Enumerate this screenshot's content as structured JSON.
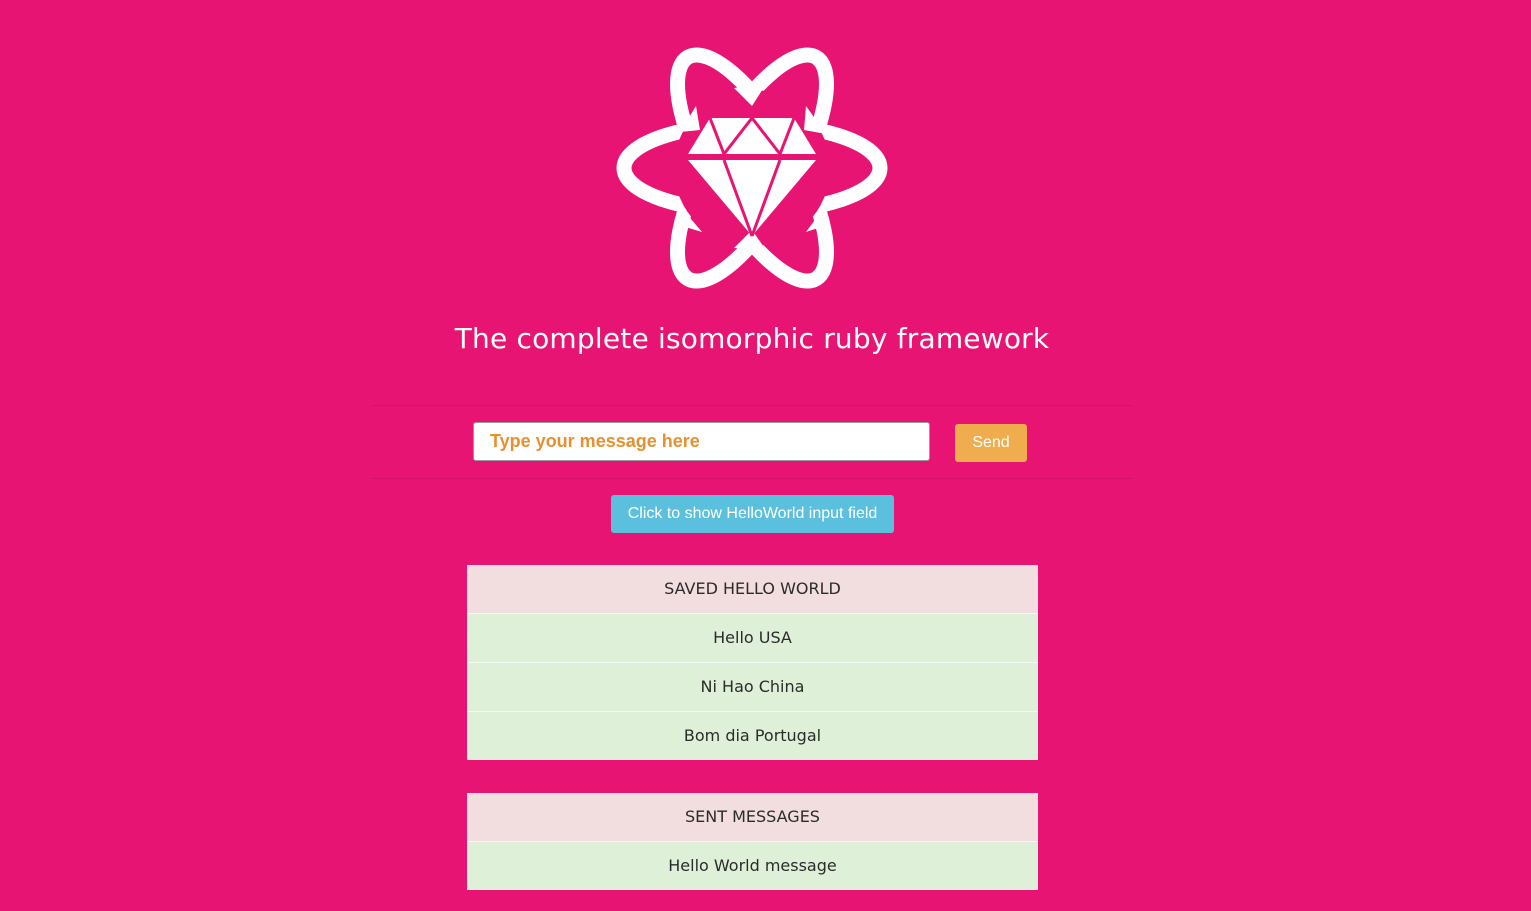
{
  "header": {
    "tagline": "The complete isomorphic ruby framework"
  },
  "logo": {
    "icon": "volt-diamond-atom-logo"
  },
  "message_form": {
    "placeholder": "Type your message here",
    "value": "",
    "send_label": "Send"
  },
  "toggle_button": {
    "label": "Click to show HelloWorld input field"
  },
  "saved_table": {
    "header": "SAVED HELLO WORLD",
    "rows": [
      "Hello USA",
      "Ni Hao China",
      "Bom dia Portugal"
    ]
  },
  "sent_table": {
    "header": "SENT MESSAGES",
    "rows": [
      "Hello World message"
    ]
  },
  "colors": {
    "background": "#e81473",
    "send_button": "#f0ad4e",
    "info_button": "#5bc0de",
    "table_header": "#f2dede",
    "table_row": "#dff0d8",
    "placeholder": "#e8902f"
  }
}
